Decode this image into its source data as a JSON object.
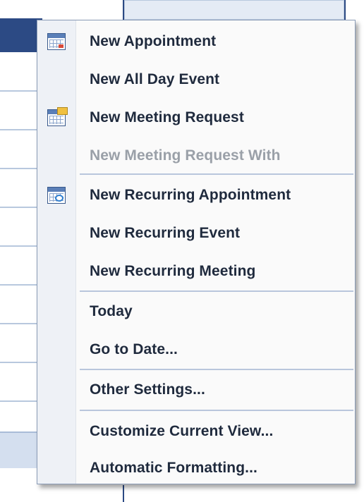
{
  "context_menu": {
    "items": [
      {
        "label": "New Appointment",
        "icon": "calendar-icon",
        "enabled": true
      },
      {
        "label": "New All Day Event",
        "icon": "",
        "enabled": true
      },
      {
        "label": "New Meeting Request",
        "icon": "meeting-request-icon",
        "enabled": true
      },
      {
        "label": "New Meeting Request With",
        "icon": "",
        "enabled": false
      },
      {
        "label": "New Recurring Appointment",
        "icon": "recurring-appointment-icon",
        "enabled": true
      },
      {
        "label": "New Recurring Event",
        "icon": "",
        "enabled": true
      },
      {
        "label": "New Recurring Meeting",
        "icon": "",
        "enabled": true
      },
      {
        "label": "Today",
        "icon": "",
        "enabled": true
      },
      {
        "label": "Go to Date...",
        "icon": "",
        "enabled": true
      },
      {
        "label": "Other Settings...",
        "icon": "",
        "enabled": true
      },
      {
        "label": "Customize Current View...",
        "icon": "",
        "enabled": true
      },
      {
        "label": "Automatic Formatting...",
        "icon": "",
        "enabled": true
      }
    ]
  },
  "colors": {
    "menu_background": "#fafafa",
    "menu_border": "#8a9bb6",
    "text": "#1f2a3d",
    "disabled_text": "#9aa0a8",
    "calendar_selected": "#2c4a84"
  }
}
